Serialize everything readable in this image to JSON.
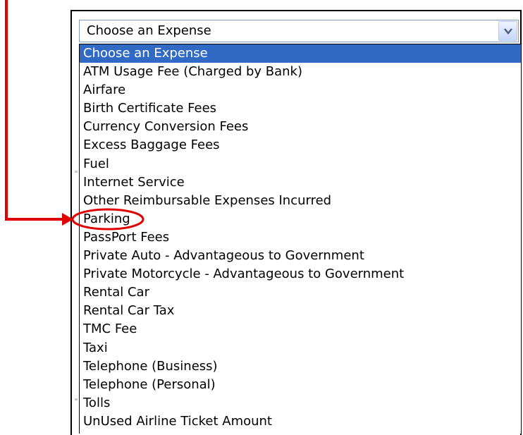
{
  "select": {
    "value": "Choose an Expense",
    "dropdown_icon": "chevron-down-icon"
  },
  "options": [
    "Choose an Expense",
    "ATM Usage Fee (Charged by Bank)",
    "Airfare",
    "Birth Certificate Fees",
    "Currency Conversion Fees",
    "Excess Baggage Fees",
    "Fuel",
    "Internet Service",
    "Other Reimbursable Expenses Incurred",
    "Parking",
    "PassPort Fees",
    "Private Auto - Advantageous to Government",
    "Private Motorcycle - Advantageous to Government",
    "Rental Car",
    "Rental Car Tax",
    "TMC Fee",
    "Taxi",
    "Telephone (Business)",
    "Telephone (Personal)",
    "Tolls",
    "UnUsed Airline Ticket Amount"
  ],
  "selected_option": "Choose an Expense",
  "highlighted_option": "Parking",
  "colors": {
    "selection": "#316ac5",
    "annotation": "#e00000",
    "select_border": "#7f9db9"
  }
}
